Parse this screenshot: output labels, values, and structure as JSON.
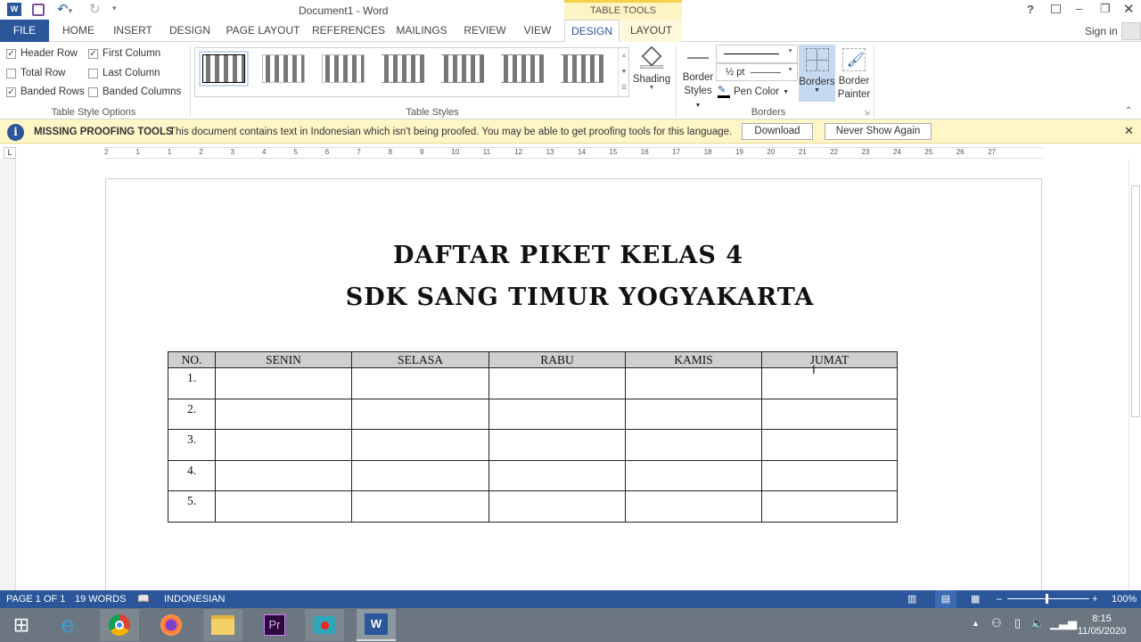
{
  "title": "Document1 - Word",
  "contextual_tab": "TABLE TOOLS",
  "window_controls": [
    "?",
    "restore-ribbon",
    "minimize",
    "maximize",
    "close"
  ],
  "tabs": [
    "FILE",
    "HOME",
    "INSERT",
    "DESIGN",
    "PAGE LAYOUT",
    "REFERENCES",
    "MAILINGS",
    "REVIEW",
    "VIEW",
    "DESIGN",
    "LAYOUT"
  ],
  "active_tab": "DESIGN",
  "sign_in": "Sign in",
  "style_options": {
    "group": "Table Style Options",
    "items": [
      {
        "label": "Header Row",
        "checked": true
      },
      {
        "label": "First Column",
        "checked": true
      },
      {
        "label": "Total Row",
        "checked": false
      },
      {
        "label": "Last Column",
        "checked": false
      },
      {
        "label": "Banded Rows",
        "checked": true
      },
      {
        "label": "Banded Columns",
        "checked": false
      }
    ]
  },
  "table_styles": {
    "group": "Table Styles"
  },
  "shading": "Shading",
  "borders": {
    "group": "Borders",
    "border_styles": [
      "Border",
      "Styles"
    ],
    "weight": "½ pt",
    "pen_color": "Pen Color",
    "borders_btn": "Borders",
    "painter": [
      "Border",
      "Painter"
    ]
  },
  "infobar": {
    "title": "MISSING PROOFING TOOLS",
    "message": "This document contains text in Indonesian which isn't being proofed. You may be able to get proofing tools for this language.",
    "download": "Download",
    "never": "Never Show Again"
  },
  "ruler_numbers": [
    "2",
    "1",
    "1",
    "2",
    "3",
    "4",
    "5",
    "6",
    "7",
    "8",
    "9",
    "10",
    "11",
    "12",
    "13",
    "14",
    "15",
    "16",
    "17",
    "18",
    "19",
    "20",
    "21",
    "22",
    "23",
    "24",
    "25",
    "26",
    "27"
  ],
  "document": {
    "title1": "DAFTAR PIKET KELAS 4",
    "title2": "SDK SANG TIMUR YOGYAKARTA",
    "headers": [
      "NO.",
      "SENIN",
      "SELASA",
      "RABU",
      "KAMIS",
      "JUMAT"
    ],
    "rows": [
      "1.",
      "2.",
      "3.",
      "4.",
      "5."
    ]
  },
  "status": {
    "page": "PAGE 1 OF 1",
    "words": "19 WORDS",
    "language": "INDONESIAN",
    "zoom": "100%"
  },
  "clock": {
    "time": "8:15",
    "date": "11/05/2020"
  },
  "colors": {
    "accent": "#2b579a",
    "infobar": "#fff6c8",
    "contextual": "#fdf4c4"
  }
}
